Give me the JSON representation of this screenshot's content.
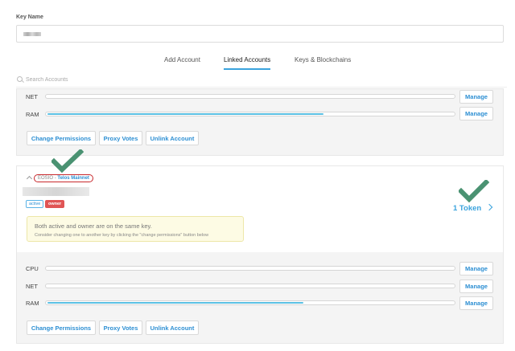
{
  "key_name": {
    "label": "Key Name"
  },
  "tabs": [
    {
      "label": "Add Account"
    },
    {
      "label": "Linked Accounts",
      "active": true
    },
    {
      "label": "Keys & Blockchains"
    }
  ],
  "search": {
    "placeholder": "Search Accounts"
  },
  "account1": {
    "resources": [
      {
        "label": "NET",
        "fill": 0.0,
        "button": "Manage"
      },
      {
        "label": "RAM",
        "fill": 0.68,
        "button": "Manage"
      }
    ],
    "actions": [
      "Change Permissions",
      "Proxy Votes",
      "Unlink Account"
    ]
  },
  "account2": {
    "chain": {
      "name": "EOSIO",
      "separator": "-",
      "network": "Telos Mainnet"
    },
    "permissions": [
      "active",
      "owner"
    ],
    "tokens": {
      "label": "1 Token"
    },
    "warning": {
      "title": "Both active and owner are on the same key.",
      "subtitle": "Consider changing one to another key by clicking the \"change permissions\" button below"
    },
    "resources": [
      {
        "label": "CPU",
        "fill": 0.0,
        "button": "Manage"
      },
      {
        "label": "NET",
        "fill": 0.0,
        "button": "Manage"
      },
      {
        "label": "RAM",
        "fill": 0.63,
        "button": "Manage"
      }
    ],
    "actions": [
      "Change Permissions",
      "Proxy Votes",
      "Unlink Account"
    ]
  },
  "colors": {
    "accent": "#3aa3dd",
    "bar_fill": "#5bc0e3",
    "owner_badge": "#e05454",
    "annotation_check": "#4a9272",
    "annotation_circle": "#c8282c"
  },
  "icons": [
    "search-icon",
    "caret-up-icon",
    "chevron-right-icon",
    "checkmark-annotation-icon"
  ]
}
